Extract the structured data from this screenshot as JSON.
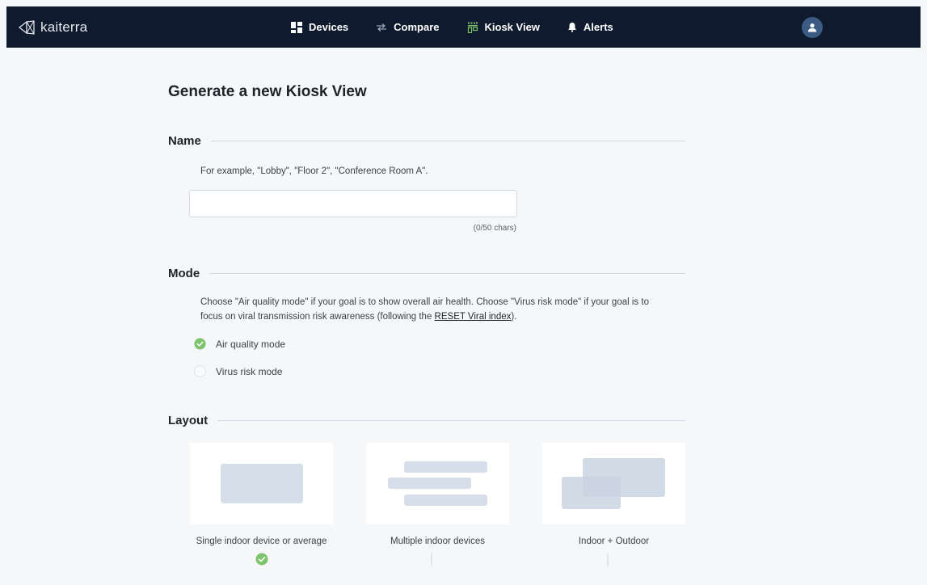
{
  "app": {
    "logo_text": "kaiterra"
  },
  "nav": {
    "items": [
      {
        "label": "Devices",
        "icon": "grid-icon"
      },
      {
        "label": "Compare",
        "icon": "arrows-icon"
      },
      {
        "label": "Kiosk View",
        "icon": "kiosk-icon"
      },
      {
        "label": "Alerts",
        "icon": "bell-icon"
      }
    ],
    "avatar_icon": "user-icon"
  },
  "page": {
    "title": "Generate a new Kiosk View"
  },
  "name_section": {
    "label": "Name",
    "help": "For example, \"Lobby\", \"Floor 2\", \"Conference Room A\".",
    "value": "",
    "placeholder": "",
    "char_count": "(0/50 chars)"
  },
  "mode_section": {
    "label": "Mode",
    "help_line1": "Choose \"Air quality mode\" if your goal is to show overall air health. Choose \"Virus risk mode\" if your goal is to",
    "help_line2_prefix": "focus on viral transmission risk awareness (following the ",
    "help_link": "RESET Viral index",
    "help_line2_suffix": ").",
    "options": [
      {
        "label": "Air quality mode",
        "selected": true
      },
      {
        "label": "Virus risk mode",
        "selected": false
      }
    ]
  },
  "layout_section": {
    "label": "Layout",
    "options": [
      {
        "label": "Single indoor device or average",
        "selected": true
      },
      {
        "label": "Multiple indoor devices",
        "selected": false
      },
      {
        "label": "Indoor + Outdoor",
        "selected": false
      }
    ]
  },
  "colors": {
    "nav_bg": "#0f1a2e",
    "check_green": "#7dc36b",
    "placeholder_shape": "#d6dfe9"
  }
}
